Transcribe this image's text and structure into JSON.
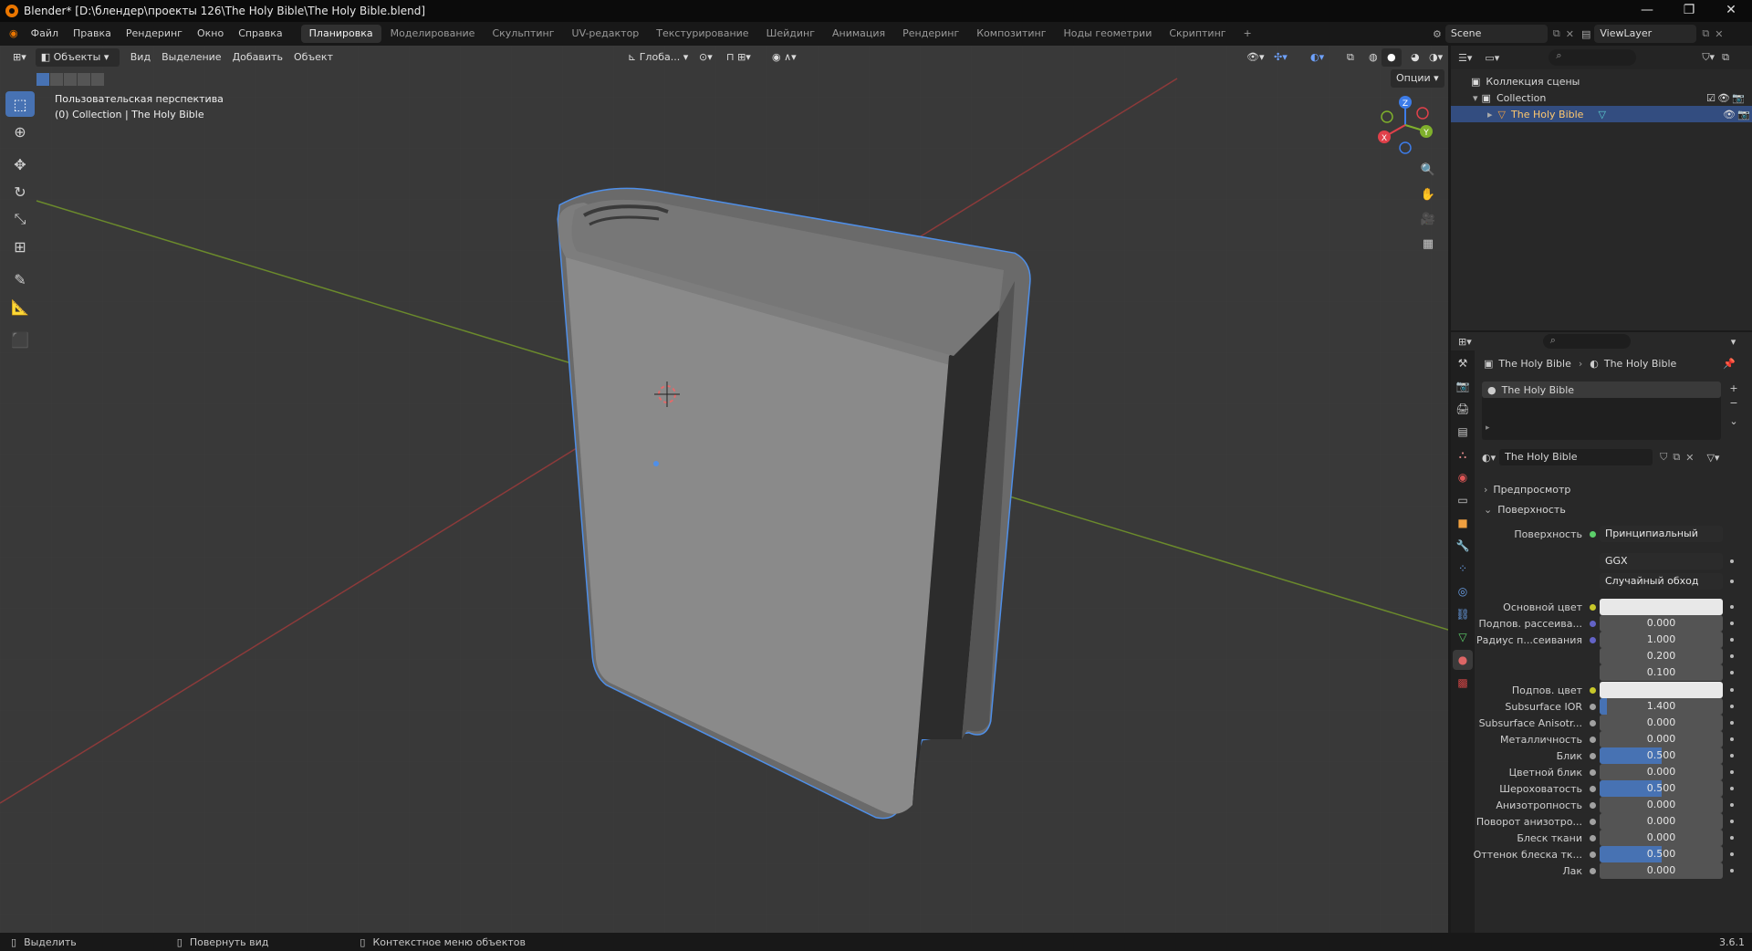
{
  "title": "Blender* [D:\\блендер\\проекты 126\\The Holy Bible\\The Holy Bible.blend]",
  "window_controls": {
    "minimize": "—",
    "maximize": "❐",
    "close": "✕"
  },
  "menu": [
    "Файл",
    "Правка",
    "Рендеринг",
    "Окно",
    "Справка"
  ],
  "workspaces": [
    {
      "label": "Планировка",
      "active": true
    },
    {
      "label": "Моделирование"
    },
    {
      "label": "Скульптинг"
    },
    {
      "label": "UV-редактор"
    },
    {
      "label": "Текстурирование"
    },
    {
      "label": "Шейдинг"
    },
    {
      "label": "Анимация"
    },
    {
      "label": "Рендеринг"
    },
    {
      "label": "Композитинг"
    },
    {
      "label": "Ноды геометрии"
    },
    {
      "label": "Скриптинг"
    }
  ],
  "add_workspace": "+",
  "scene": "Scene",
  "view_layer": "ViewLayer",
  "viewport": {
    "mode": "Объекты",
    "menus": [
      "Вид",
      "Выделение",
      "Добавить",
      "Объект"
    ],
    "transform_orientation": "Глоба...",
    "options": "Опции",
    "view_name": "Пользовательская перспектива",
    "collection_info": "(0) Collection | The Holy Bible",
    "gizmo": {
      "x": "X",
      "y": "Y",
      "z": "Z"
    }
  },
  "tools": [
    {
      "name": "select-box-tool",
      "icon": "⬚",
      "active": true
    },
    {
      "name": "cursor-tool",
      "icon": "⊕"
    },
    {
      "name": "move-tool",
      "icon": "✥"
    },
    {
      "name": "rotate-tool",
      "icon": "↻"
    },
    {
      "name": "scale-tool",
      "icon": "⤡"
    },
    {
      "name": "transform-tool",
      "icon": "⊞"
    },
    {
      "name": "annotate-tool",
      "icon": "✎"
    },
    {
      "name": "measure-tool",
      "icon": "📐"
    },
    {
      "name": "add-cube-tool",
      "icon": "⬛"
    }
  ],
  "outliner": {
    "scene_collection": "Коллекция сцены",
    "collection": "Collection",
    "object": "The Holy Bible"
  },
  "properties": {
    "breadcrumb": [
      "The Holy Bible",
      "The Holy Bible"
    ],
    "material_slot": "The Holy Bible",
    "material_name": "The Holy Bible",
    "panels": {
      "preview": "Предпросмотр",
      "surface": "Поверхность"
    },
    "surface_label": "Поверхность",
    "surface_value": "Принципиальный BSDF",
    "distribution": "GGX",
    "subsurface_method": "Случайный обход",
    "rows": [
      {
        "label": "Основной цвет",
        "type": "color",
        "value": "",
        "dot": "#c7c729"
      },
      {
        "label": "Подпов. рассеива...",
        "value": "0.000",
        "dot": "#6363c7"
      },
      {
        "label": "Радиус п...сеивания",
        "value": "1.000",
        "dot": "#6363c7"
      },
      {
        "label": "",
        "value": "0.200"
      },
      {
        "label": "",
        "value": "0.100"
      },
      {
        "label": "Подпов. цвет",
        "type": "color",
        "value": "",
        "dot": "#c7c729"
      },
      {
        "label": "Subsurface IOR",
        "value": "1.400",
        "dot": "#a1a1a1",
        "fill": 0.06
      },
      {
        "label": "Subsurface Anisotr...",
        "value": "0.000",
        "dot": "#a1a1a1"
      },
      {
        "label": "Металличность",
        "value": "0.000",
        "dot": "#a1a1a1"
      },
      {
        "label": "Блик",
        "value": "0.500",
        "dot": "#a1a1a1",
        "fill": 0.5
      },
      {
        "label": "Цветной блик",
        "value": "0.000",
        "dot": "#a1a1a1"
      },
      {
        "label": "Шероховатость",
        "value": "0.500",
        "dot": "#a1a1a1",
        "fill": 0.5
      },
      {
        "label": "Анизотропность",
        "value": "0.000",
        "dot": "#a1a1a1"
      },
      {
        "label": "Поворот анизотро...",
        "value": "0.000",
        "dot": "#a1a1a1"
      },
      {
        "label": "Блеск ткани",
        "value": "0.000",
        "dot": "#a1a1a1"
      },
      {
        "label": "Оттенок блеска тк...",
        "value": "0.500",
        "dot": "#a1a1a1",
        "fill": 0.5
      },
      {
        "label": "Лак",
        "value": "0.000",
        "dot": "#a1a1a1"
      }
    ]
  },
  "status": {
    "select": "Выделить",
    "rotate": "Повернуть вид",
    "context": "Контекстное меню объектов",
    "version": "3.6.1"
  },
  "colors": {
    "accent": "#4772b3",
    "selection_outline": "#4f8fe8",
    "viewport_bg": "#393939"
  }
}
